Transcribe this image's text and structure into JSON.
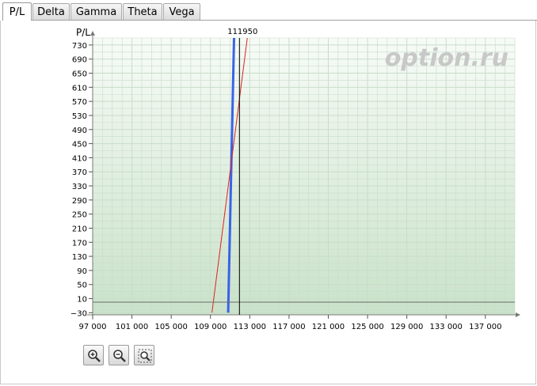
{
  "tabs": [
    {
      "label": "P/L",
      "active": true
    },
    {
      "label": "Delta",
      "active": false
    },
    {
      "label": "Gamma",
      "active": false
    },
    {
      "label": "Theta",
      "active": false
    },
    {
      "label": "Vega",
      "active": false
    }
  ],
  "watermark": "option.ru",
  "zoom_buttons": [
    {
      "icon": "zoom-in-icon"
    },
    {
      "icon": "zoom-out-icon"
    },
    {
      "icon": "zoom-fit-icon"
    }
  ],
  "colors": {
    "grid": "#c9dcc9",
    "plot_top": "#f7fbf7",
    "plot_bottom": "#c9e2c9",
    "blue_series": "#3a62e8",
    "red_series": "#e02020",
    "marker": "#000000",
    "watermark": "#c8c8c8"
  },
  "chart_data": {
    "type": "line",
    "ylabel": "P/L",
    "xlim": [
      97000,
      140000
    ],
    "ylim": [
      -30,
      750
    ],
    "x_ticks": [
      97000,
      101000,
      105000,
      109000,
      113000,
      117000,
      121000,
      125000,
      129000,
      133000,
      137000
    ],
    "x_tick_labels": [
      "97 000",
      "101 000",
      "105 000",
      "109 000",
      "113 000",
      "117 000",
      "121 000",
      "125 000",
      "129 000",
      "133 000",
      "137 000"
    ],
    "y_ticks": [
      -30,
      10,
      50,
      90,
      130,
      170,
      210,
      250,
      290,
      330,
      370,
      410,
      450,
      490,
      530,
      570,
      610,
      650,
      690,
      730
    ],
    "y_tick_labels": [
      "−30",
      "10",
      "50",
      "90",
      "130",
      "170",
      "210",
      "250",
      "290",
      "330",
      "370",
      "410",
      "450",
      "490",
      "530",
      "570",
      "610",
      "650",
      "690",
      "730"
    ],
    "grid": true,
    "marker": {
      "x": 111950,
      "label": "111950"
    },
    "series": [
      {
        "color": "#3a62e8",
        "points": [
          [
            110800,
            -30
          ],
          [
            111400,
            750
          ]
        ]
      },
      {
        "color": "#e02020",
        "points": [
          [
            109150,
            -30
          ],
          [
            112750,
            750
          ]
        ]
      }
    ]
  }
}
